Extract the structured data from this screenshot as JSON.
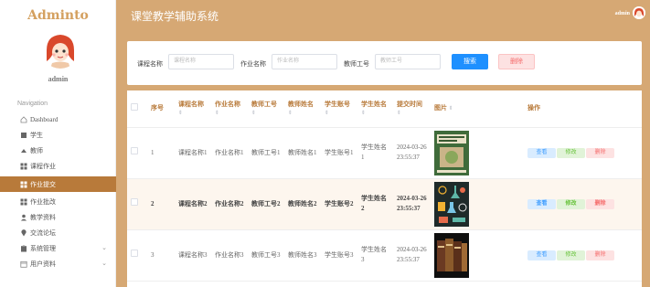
{
  "app": {
    "logo": "Adminto",
    "username": "admin",
    "header_title": "课堂教学辅助系统",
    "header_user": "admin"
  },
  "sidebar": {
    "nav_title": "Navigation",
    "items": [
      {
        "label": "Dashboard",
        "icon": "home-icon",
        "active": false
      },
      {
        "label": "学生",
        "icon": "student-icon",
        "active": false
      },
      {
        "label": "教师",
        "icon": "teacher-icon",
        "active": false
      },
      {
        "label": "课程作业",
        "icon": "grid-icon",
        "active": false
      },
      {
        "label": "作业提交",
        "icon": "grid-icon",
        "active": true
      },
      {
        "label": "作业批改",
        "icon": "grid-icon",
        "active": false
      },
      {
        "label": "教学资料",
        "icon": "user-icon",
        "active": false
      },
      {
        "label": "交流论坛",
        "icon": "pin-icon",
        "active": false
      },
      {
        "label": "系统管理",
        "icon": "clipboard-icon",
        "active": false,
        "expandable": true
      },
      {
        "label": "用户资料",
        "icon": "calendar-icon",
        "active": false,
        "expandable": true
      }
    ]
  },
  "search": {
    "course_label": "课程名称",
    "course_placeholder": "课程名称",
    "homework_label": "作业名称",
    "homework_placeholder": "作业名称",
    "teacher_no_label": "教师工号",
    "teacher_no_placeholder": "教师工号",
    "search_button": "搜索",
    "delete_button": "删除"
  },
  "table": {
    "headers": [
      "序号",
      "课程名称",
      "作业名称",
      "教师工号",
      "教师姓名",
      "学生账号",
      "学生姓名",
      "提交时间",
      "图片",
      "操作"
    ],
    "rows": [
      {
        "index": "1",
        "course": "课程名称1",
        "homework": "作业名称1",
        "teacher_no": "教师工号1",
        "teacher_name": "教师姓名1",
        "student_account": "学生账号1",
        "student_name": "学生姓名1",
        "submit_time": "2024-03-26 23:55:37",
        "image": "book-cover"
      },
      {
        "index": "2",
        "course": "课程名称2",
        "homework": "作业名称2",
        "teacher_no": "教师工号2",
        "teacher_name": "教师姓名2",
        "student_account": "学生账号2",
        "student_name": "学生姓名2",
        "submit_time": "2024-03-26 23:55:37",
        "image": "science-icons"
      },
      {
        "index": "3",
        "course": "课程名称3",
        "homework": "作业名称3",
        "teacher_no": "教师工号3",
        "teacher_name": "教师姓名3",
        "student_account": "学生账号3",
        "student_name": "学生姓名3",
        "submit_time": "2024-03-26 23:55:37",
        "image": "book-set"
      }
    ],
    "actions": {
      "view": "查看",
      "edit": "修改",
      "delete": "删除"
    }
  },
  "colors": {
    "accent": "#d6a874",
    "active_nav": "#b87a3a",
    "primary_button": "#1e90ff"
  }
}
